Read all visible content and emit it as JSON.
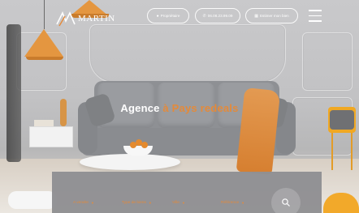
{
  "header": {
    "logo_text": "MARTIN",
    "nav": [
      {
        "label": "Propriétaire",
        "icon": "user-icon"
      },
      {
        "label": "06.08.23.99.09",
        "icon": "phone-icon"
      },
      {
        "label": "Estimer mon bien",
        "icon": "calculator-icon"
      }
    ],
    "menu_icon": "hamburger-menu-icon"
  },
  "hero": {
    "headline_main": "Agence",
    "headline_accent": "à Pays redeals"
  },
  "search": {
    "fields": [
      {
        "label": "A vendre"
      },
      {
        "label": "Type de biens"
      },
      {
        "label": "Ville"
      },
      {
        "label": "Référence"
      }
    ],
    "submit_icon": "search-icon"
  },
  "colors": {
    "accent": "#e48a3a",
    "search_bar": "#8f9093"
  }
}
